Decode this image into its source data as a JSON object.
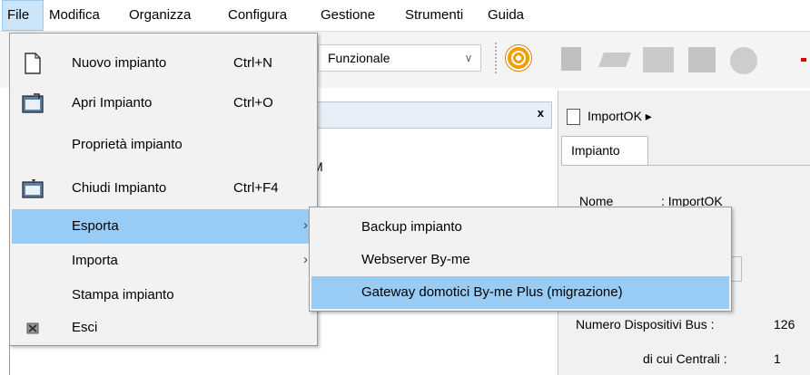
{
  "menubar": {
    "items": [
      "File",
      "Modifica",
      "Organizza",
      "Configura",
      "Gestione",
      "Strumenti",
      "Guida"
    ]
  },
  "toolbar": {
    "view_combo_value": "Funzionale",
    "icons": [
      "target-icon",
      "building-icon",
      "layers-icon",
      "rooms-icon",
      "floor-icon",
      "sphere-icon"
    ]
  },
  "file_menu": {
    "items": [
      {
        "label": "Nuovo impianto",
        "shortcut": "Ctrl+N",
        "icon": "new-document-icon"
      },
      {
        "label": "Apri Impianto",
        "shortcut": "Ctrl+O",
        "icon": "open-folder-icon"
      },
      {
        "label": "Proprietà impianto",
        "shortcut": "",
        "icon": ""
      },
      {
        "label": "Chiudi Impianto",
        "shortcut": "Ctrl+F4",
        "icon": "close-folder-icon"
      },
      {
        "label": "Esporta",
        "shortcut": "",
        "icon": "",
        "submenu": true,
        "highlighted": true
      },
      {
        "label": "Importa",
        "shortcut": "",
        "icon": "",
        "submenu": true
      },
      {
        "label": "Stampa impianto",
        "shortcut": "",
        "icon": ""
      },
      {
        "label": "Esci",
        "shortcut": "",
        "icon": "exit-icon"
      }
    ],
    "submenu_arrow": "›"
  },
  "export_submenu": {
    "items": [
      {
        "label": "Backup impianto"
      },
      {
        "label": "Webserver By-me"
      },
      {
        "label": "Gateway domotici By-me Plus (migrazione)",
        "highlighted": true
      }
    ]
  },
  "left_panel": {
    "close_glyph": "x",
    "partial_text": "M"
  },
  "right_panel": {
    "breadcrumb": "ImportOK",
    "breadcrumb_arrow": "▸",
    "tab": "Impianto",
    "name_label": "Nome",
    "name_value": ": ImportOK",
    "bus_devices_label": "Numero Dispositivi Bus :",
    "bus_devices_value": "126",
    "central_label": "di cui Centrali :",
    "central_value": "1"
  },
  "colors": {
    "highlight": "#99ccf5",
    "menu_bg": "#f2f2f2",
    "menubar_active": "#cce4f7"
  }
}
